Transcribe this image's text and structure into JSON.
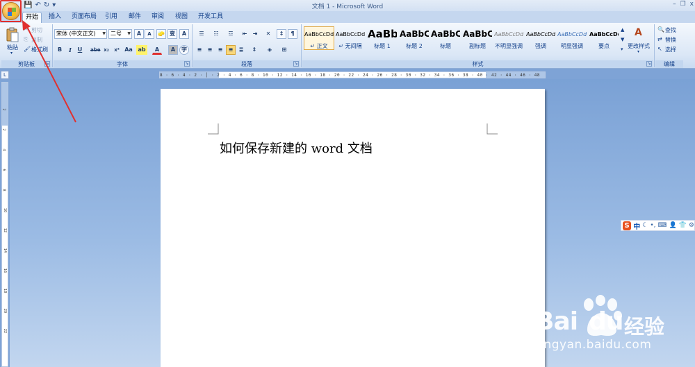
{
  "window": {
    "title": "文档 1 - Microsoft Word",
    "minimize": "–",
    "restore": "❐",
    "close": "x"
  },
  "qat": {
    "save": "💾",
    "undo": "↶",
    "redo": "↻",
    "more": "▾"
  },
  "tabs": [
    {
      "label": "开始",
      "active": true
    },
    {
      "label": "插入"
    },
    {
      "label": "页面布局"
    },
    {
      "label": "引用"
    },
    {
      "label": "邮件"
    },
    {
      "label": "审阅"
    },
    {
      "label": "视图"
    },
    {
      "label": "开发工具"
    }
  ],
  "clipboard": {
    "paste": "粘贴",
    "cut": "剪切",
    "copy": "复制",
    "format_painter": "格式刷",
    "label": "剪贴板"
  },
  "font": {
    "name": "宋体 (中文正文)",
    "size": "二号",
    "grow": "A",
    "shrink": "A",
    "clear": "🧽",
    "phonetic": "变",
    "border_char": "A",
    "bold": "B",
    "italic": "I",
    "underline": "U",
    "strike": "abe",
    "subscript": "x₂",
    "superscript": "x²",
    "change_case": "Aa",
    "highlight": "ab",
    "font_color": "A",
    "shade": "A",
    "enclose": "字",
    "label": "字体"
  },
  "paragraph": {
    "label": "段落"
  },
  "styles": {
    "items": [
      {
        "preview": "AaBbCcDd",
        "name": "↵ 正文",
        "selected": true
      },
      {
        "preview": "AaBbCcDd",
        "name": "↵ 无间隔"
      },
      {
        "preview": "AaBb",
        "name": "标题 1"
      },
      {
        "preview": "AaBbC",
        "name": "标题 2"
      },
      {
        "preview": "AaBbC",
        "name": "标题"
      },
      {
        "preview": "AaBbC",
        "name": "副标题"
      },
      {
        "preview": "AaBbCcDd",
        "name": "不明显强调"
      },
      {
        "preview": "AaBbCcDd",
        "name": "强调"
      },
      {
        "preview": "AaBbCcDd",
        "name": "明显强调"
      },
      {
        "preview": "AaBbCcDd",
        "name": "要点"
      }
    ],
    "change": "更改样式",
    "label": "样式"
  },
  "editing": {
    "find": "查找",
    "replace": "替换",
    "select": "选择",
    "label": "编辑"
  },
  "ruler": {
    "h_ticks": "8 · 6 · 4 · 2 · │ · 2 · 4 · 6 · 8 · 10 · 12 · 14 · 16 · 18 · 20 · 22 · 24 · 26 · 28 · 30 · 32 · 34 · 36 · 38 · 40 · 42 · 44 · 46 · 48",
    "v_numbers": [
      "2",
      "2",
      "4",
      "6",
      "8",
      "10",
      "12",
      "14",
      "16",
      "18",
      "20",
      "22"
    ]
  },
  "document": {
    "text": "如何保存新建的 word 文档"
  },
  "ime": {
    "logo": "S",
    "mode": "中",
    "icons": [
      "☾",
      "•,",
      "⌨",
      "👤",
      "👕",
      "⚙"
    ]
  },
  "watermark": {
    "brand": "Bai",
    "brand_suffix": "du",
    "cn": "经验",
    "url": "jingyan.baidu.com"
  },
  "colors": {
    "highlight_red": "#e0302f",
    "arrow_red": "#e0302f",
    "ribbon_blue": "#15428b"
  }
}
